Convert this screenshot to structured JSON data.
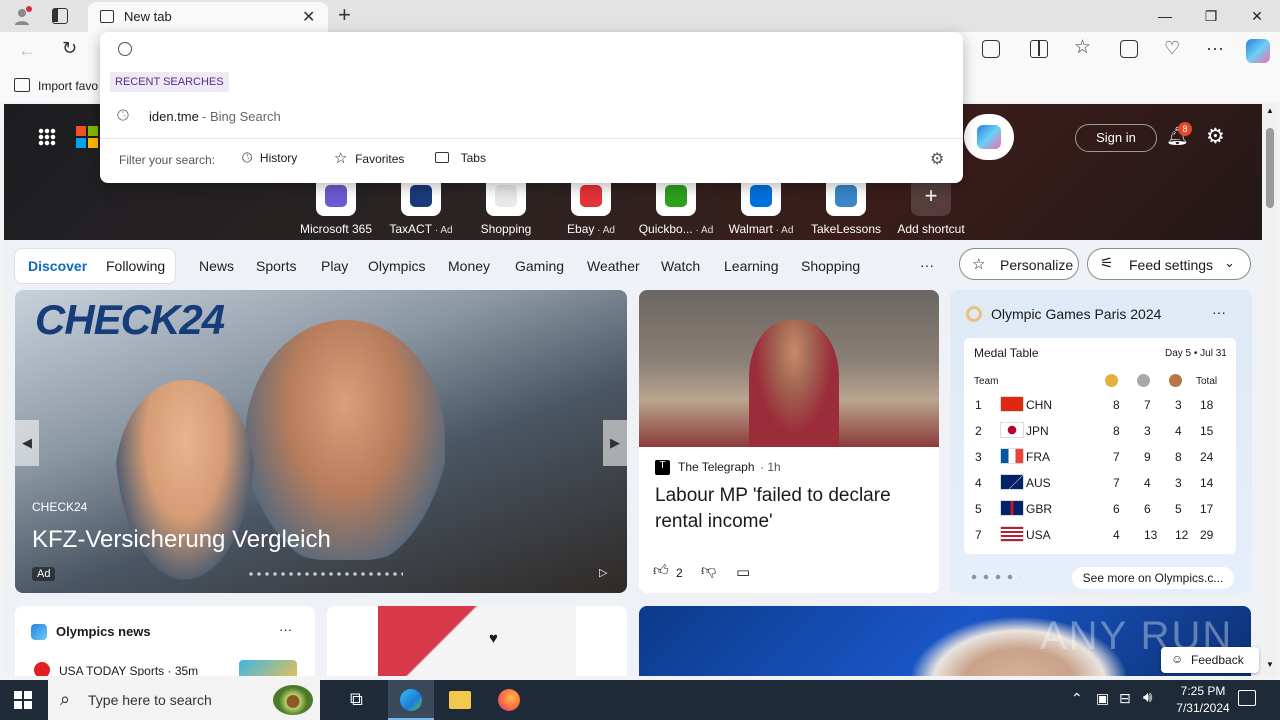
{
  "browser": {
    "tab_title": "New tab",
    "favorites_bar": {
      "import_label": "Import favo"
    }
  },
  "omnibox": {
    "section_label": "RECENT SEARCHES",
    "recent": [
      {
        "query": "iden.tme",
        "suffix": " - Bing Search"
      }
    ],
    "filter_label": "Filter your search:",
    "filters": [
      "History",
      "Favorites",
      "Tabs"
    ]
  },
  "header": {
    "sign_in": "Sign in",
    "notification_count": "8"
  },
  "shortcuts": [
    {
      "label": "Microsoft 365",
      "ad": "",
      "color": "#6b5bd2"
    },
    {
      "label": "TaxACT",
      "ad": " · Ad",
      "color": "#1b3a7a"
    },
    {
      "label": "Shopping",
      "ad": "",
      "color": "#e8e8e8"
    },
    {
      "label": "Ebay",
      "ad": " · Ad",
      "color": "#e53238"
    },
    {
      "label": "Quickbo...",
      "ad": " · Ad",
      "color": "#2ca01c"
    },
    {
      "label": "Walmart",
      "ad": " · Ad",
      "color": "#0071dc"
    },
    {
      "label": "TakeLessons",
      "ad": "",
      "color": "#3a86c8"
    },
    {
      "label": "Add shortcut",
      "ad": "",
      "color": "#ffffff"
    }
  ],
  "feed_nav": {
    "discover": "Discover",
    "following": "Following",
    "items": [
      "News",
      "Sports",
      "Play",
      "Olympics",
      "Money",
      "Gaming",
      "Weather",
      "Watch",
      "Learning",
      "Shopping"
    ],
    "more": "···",
    "personalize": "Personalize",
    "feed_settings": "Feed settings"
  },
  "ad_card": {
    "brand_logo": "CHECK24",
    "source": "CHECK24",
    "title": "KFZ-Versicherung Vergleich",
    "ad_badge": "Ad"
  },
  "news_card": {
    "source": "The Telegraph",
    "age": "· 1h",
    "title": "Labour MP 'failed to declare rental income'",
    "likes": "2"
  },
  "olympics_widget": {
    "title": "Olympic Games Paris 2024",
    "table_title": "Medal Table",
    "day": "Day 5 • Jul 31",
    "team_header": "Team",
    "total_header": "Total",
    "rows": [
      {
        "rank": "1",
        "code": "CHN",
        "gold": "8",
        "silver": "7",
        "bronze": "3",
        "total": "18"
      },
      {
        "rank": "2",
        "code": "JPN",
        "gold": "8",
        "silver": "3",
        "bronze": "4",
        "total": "15"
      },
      {
        "rank": "3",
        "code": "FRA",
        "gold": "7",
        "silver": "9",
        "bronze": "8",
        "total": "24"
      },
      {
        "rank": "4",
        "code": "AUS",
        "gold": "7",
        "silver": "4",
        "bronze": "3",
        "total": "14"
      },
      {
        "rank": "5",
        "code": "GBR",
        "gold": "6",
        "silver": "6",
        "bronze": "5",
        "total": "17"
      },
      {
        "rank": "7",
        "code": "USA",
        "gold": "4",
        "silver": "13",
        "bronze": "12",
        "total": "29"
      }
    ],
    "see_more": "See more on Olympics.c..."
  },
  "olympics_news": {
    "title": "Olympics news",
    "item_source": "USA TODAY Sports · 35m"
  },
  "feedback": "Feedback",
  "watermark": "ANY RUN",
  "taskbar": {
    "search_placeholder": "Type here to search",
    "time": "7:25 PM",
    "date": "7/31/2024"
  }
}
